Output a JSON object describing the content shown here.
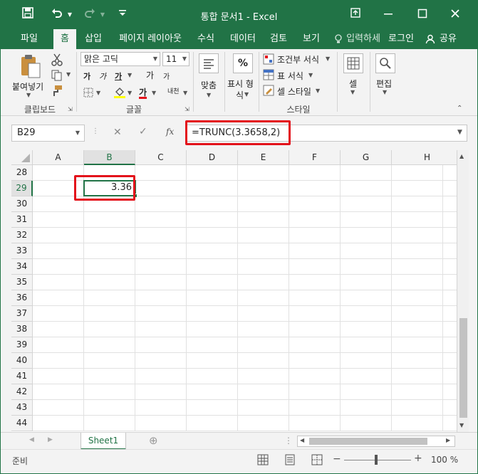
{
  "window": {
    "title": "통합 문서1 - Excel",
    "icons": [
      "save-icon",
      "undo-icon",
      "redo-icon",
      "customize-icon",
      "ribbon-display-icon",
      "minimize-icon",
      "maximize-icon",
      "close-icon"
    ]
  },
  "tabs": [
    {
      "label": "파일"
    },
    {
      "label": "홈",
      "active": true
    },
    {
      "label": "삽입"
    },
    {
      "label": "페이지 레이아웃"
    },
    {
      "label": "수식"
    },
    {
      "label": "데이터"
    },
    {
      "label": "검토"
    },
    {
      "label": "보기"
    }
  ],
  "tellme": "입력하세",
  "signin": "로그인",
  "share": "공유",
  "ribbon": {
    "clipboard": {
      "label": "클립보드",
      "paste": "붙여넣기"
    },
    "font": {
      "label": "글꼴",
      "name": "맑은 고딕",
      "size": "11",
      "ga_glyph": "가",
      "phonetic": "내천"
    },
    "align": {
      "label": "맞춤"
    },
    "number": {
      "label": "표시 형식",
      "line1": "표시 형",
      "line2": "식",
      "percent": "%"
    },
    "styles": {
      "label": "스타일",
      "cond": "조건부 서식",
      "table": "표 서식",
      "cell": "셀 스타일"
    },
    "cells": {
      "label": "셀"
    },
    "edit": {
      "label": "편집"
    }
  },
  "formula_bar": {
    "namebox": "B29",
    "fx": "fx",
    "formula": "=TRUNC(3.3658,2)"
  },
  "grid": {
    "columns": [
      "A",
      "B",
      "C",
      "D",
      "E",
      "F",
      "G",
      "H"
    ],
    "rows": [
      "28",
      "29",
      "30",
      "31",
      "32",
      "33",
      "34",
      "35",
      "36",
      "37",
      "38",
      "39",
      "40",
      "41",
      "42",
      "43",
      "44"
    ],
    "active_cell": {
      "ref": "B29",
      "value": "3.36"
    }
  },
  "sheet": {
    "name": "Sheet1"
  },
  "status": {
    "mode": "준비",
    "zoom": "100 %"
  },
  "colors": {
    "accent": "#217346",
    "highlight": "#e3121b"
  }
}
